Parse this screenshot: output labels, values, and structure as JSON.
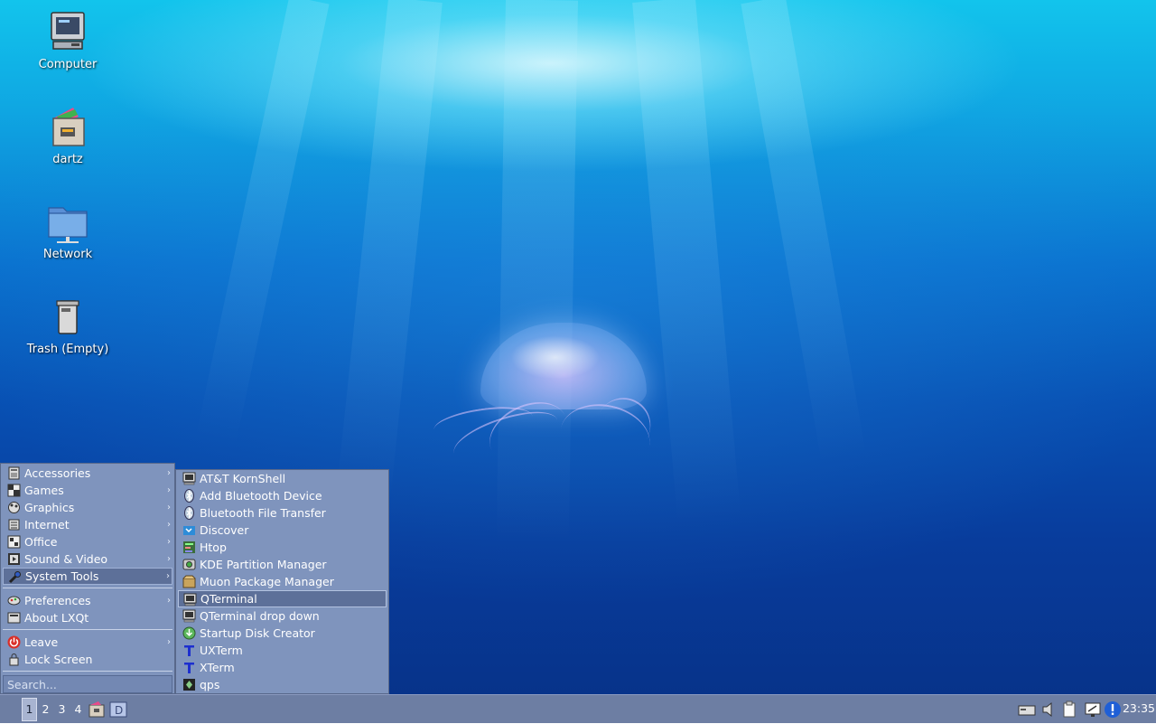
{
  "desktop": {
    "icons": [
      {
        "label": "Computer",
        "icon": "computer-icon"
      },
      {
        "label": "dartz",
        "icon": "home-folder-icon"
      },
      {
        "label": "Network",
        "icon": "network-icon"
      },
      {
        "label": "Trash (Empty)",
        "icon": "trash-icon"
      }
    ]
  },
  "menu": {
    "categories": [
      {
        "label": "Accessories",
        "icon": "accessories-icon"
      },
      {
        "label": "Games",
        "icon": "games-icon"
      },
      {
        "label": "Graphics",
        "icon": "graphics-icon"
      },
      {
        "label": "Internet",
        "icon": "internet-icon"
      },
      {
        "label": "Office",
        "icon": "office-icon"
      },
      {
        "label": "Sound & Video",
        "icon": "sound-video-icon"
      },
      {
        "label": "System Tools",
        "icon": "system-tools-icon"
      }
    ],
    "settings": [
      {
        "label": "Preferences",
        "icon": "preferences-icon"
      },
      {
        "label": "About LXQt",
        "icon": "about-icon"
      }
    ],
    "session": [
      {
        "label": "Leave",
        "icon": "power-icon"
      },
      {
        "label": "Lock Screen",
        "icon": "lock-icon"
      }
    ],
    "search_placeholder": "Search..."
  },
  "submenu": {
    "items": [
      {
        "label": "AT&T KornShell",
        "icon": "terminal-icon"
      },
      {
        "label": "Add Bluetooth Device",
        "icon": "bluetooth-icon"
      },
      {
        "label": "Bluetooth File Transfer",
        "icon": "bluetooth-icon"
      },
      {
        "label": "Discover",
        "icon": "discover-icon"
      },
      {
        "label": "Htop",
        "icon": "htop-icon"
      },
      {
        "label": "KDE Partition Manager",
        "icon": "partition-icon"
      },
      {
        "label": "Muon Package Manager",
        "icon": "package-icon"
      },
      {
        "label": "QTerminal",
        "icon": "terminal-icon"
      },
      {
        "label": "QTerminal drop down",
        "icon": "terminal-icon"
      },
      {
        "label": "Startup Disk Creator",
        "icon": "disk-creator-icon"
      },
      {
        "label": "UXTerm",
        "icon": "xterm-icon"
      },
      {
        "label": "XTerm",
        "icon": "xterm-icon"
      },
      {
        "label": "qps",
        "icon": "qps-icon"
      }
    ]
  },
  "taskbar": {
    "workspaces": [
      "1",
      "2",
      "3",
      "4"
    ],
    "clock": "23:35"
  },
  "colors": {
    "menu_bg": "#7f94bd",
    "menu_highlight": "#5d7099",
    "taskbar_bg": "#6d7ea3"
  }
}
